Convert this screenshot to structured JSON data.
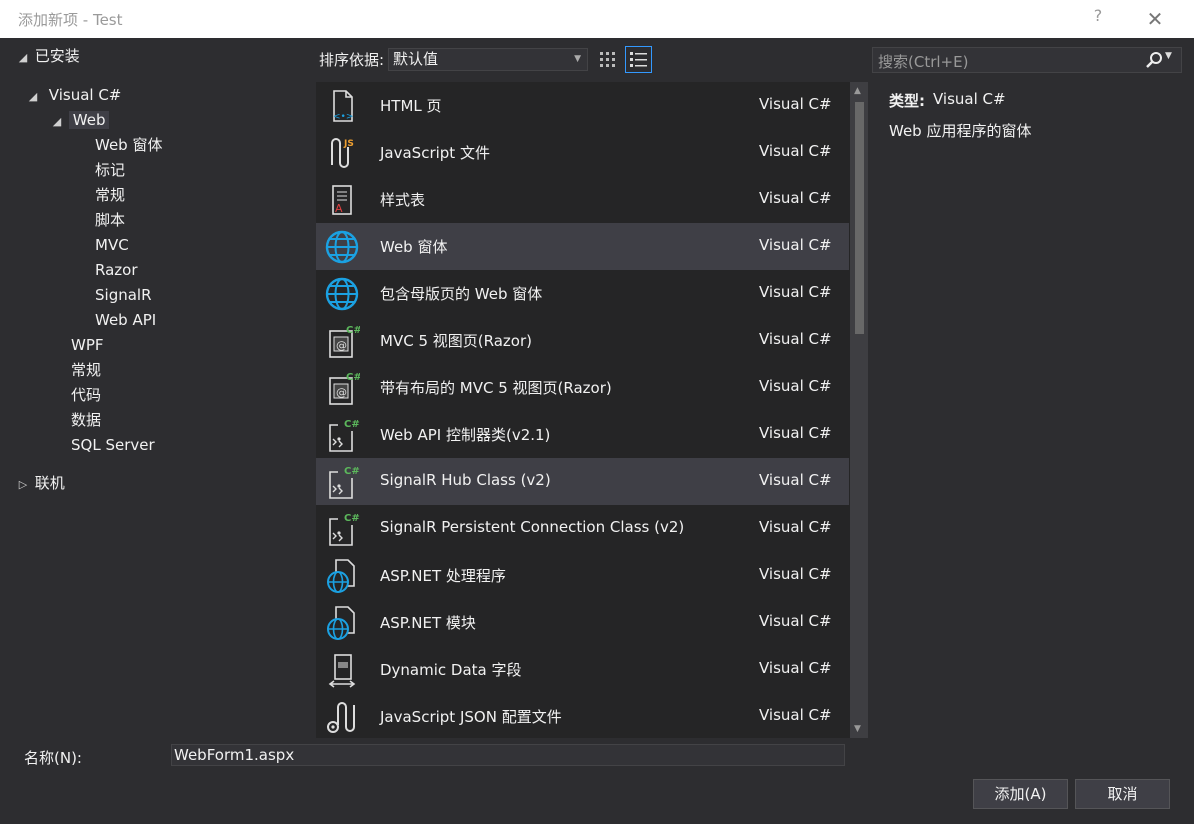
{
  "title": "添加新项 - Test",
  "help": "?",
  "close": "✕",
  "tree": {
    "installed": "已安装",
    "visual_csharp": "Visual C#",
    "web": "Web",
    "web_children": [
      "Web 窗体",
      "标记",
      "常规",
      "脚本",
      "MVC",
      "Razor",
      "SignalR",
      "Web API"
    ],
    "others": [
      "WPF",
      "常规",
      "代码",
      "数据",
      "SQL Server"
    ],
    "online": "联机"
  },
  "toolbar": {
    "sort_label": "排序依据:",
    "sort_value": "默认值",
    "search_placeholder": "搜索(Ctrl+E)"
  },
  "items": [
    {
      "name": "HTML 页",
      "lang": "Visual C#",
      "icon": "html-page-icon",
      "highlight": false
    },
    {
      "name": "JavaScript 文件",
      "lang": "Visual C#",
      "icon": "javascript-file-icon",
      "highlight": false
    },
    {
      "name": "样式表",
      "lang": "Visual C#",
      "icon": "stylesheet-icon",
      "highlight": false
    },
    {
      "name": "Web 窗体",
      "lang": "Visual C#",
      "icon": "web-form-icon",
      "highlight": true
    },
    {
      "name": "包含母版页的 Web 窗体",
      "lang": "Visual C#",
      "icon": "web-form-icon",
      "highlight": false
    },
    {
      "name": "MVC 5 视图页(Razor)",
      "lang": "Visual C#",
      "icon": "razor-view-icon",
      "highlight": false
    },
    {
      "name": "带有布局的 MVC 5 视图页(Razor)",
      "lang": "Visual C#",
      "icon": "razor-view-icon",
      "highlight": false
    },
    {
      "name": "Web API 控制器类(v2.1)",
      "lang": "Visual C#",
      "icon": "csharp-class-icon",
      "highlight": false
    },
    {
      "name": "SignalR Hub Class (v2)",
      "lang": "Visual C#",
      "icon": "csharp-class-icon",
      "highlight": true
    },
    {
      "name": "SignalR Persistent Connection Class (v2)",
      "lang": "Visual C#",
      "icon": "csharp-class-icon",
      "highlight": false
    },
    {
      "name": "ASP.NET 处理程序",
      "lang": "Visual C#",
      "icon": "aspnet-file-icon",
      "highlight": false
    },
    {
      "name": "ASP.NET 模块",
      "lang": "Visual C#",
      "icon": "aspnet-file-icon",
      "highlight": false
    },
    {
      "name": "Dynamic Data 字段",
      "lang": "Visual C#",
      "icon": "dynamic-data-icon",
      "highlight": false
    },
    {
      "name": "JavaScript JSON 配置文件",
      "lang": "Visual C#",
      "icon": "json-config-icon",
      "highlight": false
    }
  ],
  "detail": {
    "type_label": "类型:",
    "type_value": "Visual C#",
    "description": "Web 应用程序的窗体"
  },
  "bottom": {
    "name_label": "名称(N):",
    "name_value": "WebForm1.aspx",
    "add_label": "添加(A)",
    "cancel_label": "取消"
  },
  "colors": {
    "accent": "#3399ff",
    "background": "#2d2d30",
    "list_background": "#252526",
    "highlight": "#3f3f46",
    "globe_blue": "#1ba1e2",
    "csharp_green": "#5cb85c"
  }
}
